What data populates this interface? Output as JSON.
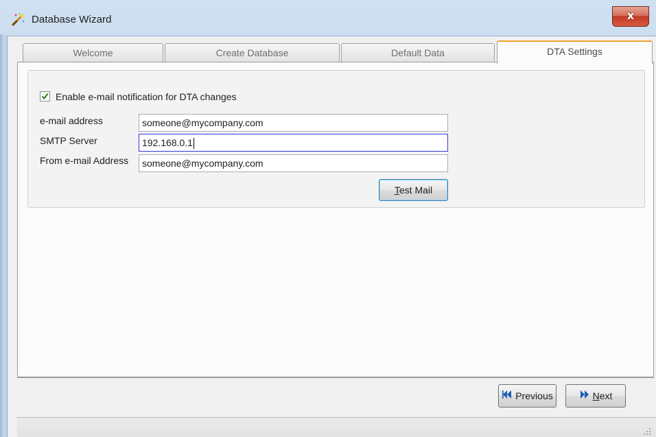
{
  "window": {
    "title": "Database Wizard",
    "close_label": "x"
  },
  "tabs": [
    {
      "label": "Welcome",
      "active": false
    },
    {
      "label": "Create Database",
      "active": false
    },
    {
      "label": "Default Data",
      "active": false
    },
    {
      "label": "DTA Settings",
      "active": true
    }
  ],
  "dta_settings": {
    "enable_notification": {
      "label": "Enable e-mail notification for DTA changes",
      "checked": true
    },
    "email_address": {
      "label": "e-mail address",
      "value": "someone@mycompany.com"
    },
    "smtp_server": {
      "label": "SMTP Server",
      "value": "192.168.0.1"
    },
    "from_email": {
      "label": "From e-mail Address",
      "value": "someone@mycompany.com"
    },
    "test_mail": {
      "prefix": "T",
      "rest": "est Mail"
    }
  },
  "nav": {
    "previous_label": "Previous",
    "next_prefix": "N",
    "next_rest": "ext"
  },
  "colors": {
    "active_tab_accent": "#f0a030",
    "focus_border": "#3838d8",
    "nav_icon_blue": "#1f5bb5"
  },
  "icons": {
    "app": "wizard-wand-icon",
    "previous": "double-chevron-left-icon",
    "next": "double-chevron-right-icon",
    "check": "checkmark-icon",
    "grip": "resize-grip-icon"
  }
}
